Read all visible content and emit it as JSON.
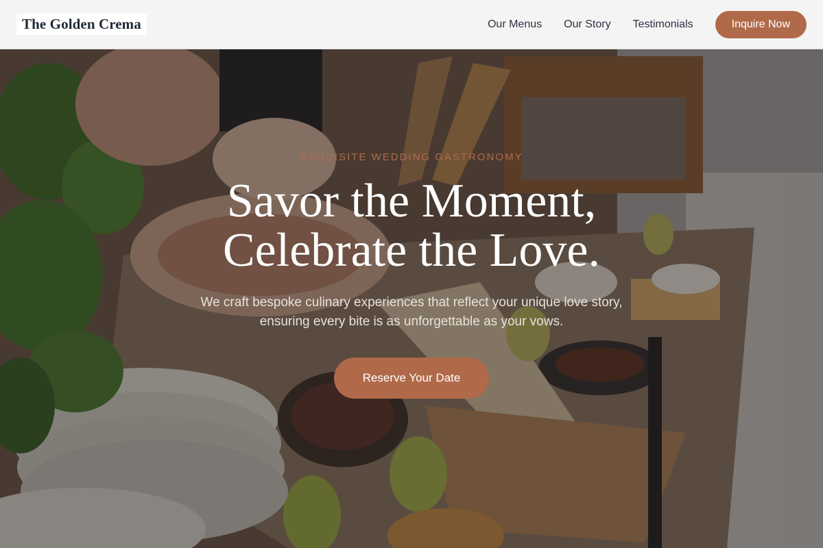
{
  "header": {
    "logo": "The Golden Crema",
    "nav": [
      "Our Menus",
      "Our Story",
      "Testimonials"
    ],
    "cta": "Inquire Now"
  },
  "hero": {
    "eyebrow": "EXQUISITE WEDDING GASTRONOMY",
    "headline_line1": "Savor the Moment,",
    "headline_line2": "Celebrate the Love.",
    "subtext_line1": "We craft bespoke culinary experiences that reflect your unique love story,",
    "subtext_line2": "ensuring every bite is as unforgettable as your vows.",
    "button": "Reserve Your Date"
  },
  "colors": {
    "accent": "#b06a4a",
    "header_bg": "#f4f4f4",
    "text_dark": "#1f2933"
  }
}
